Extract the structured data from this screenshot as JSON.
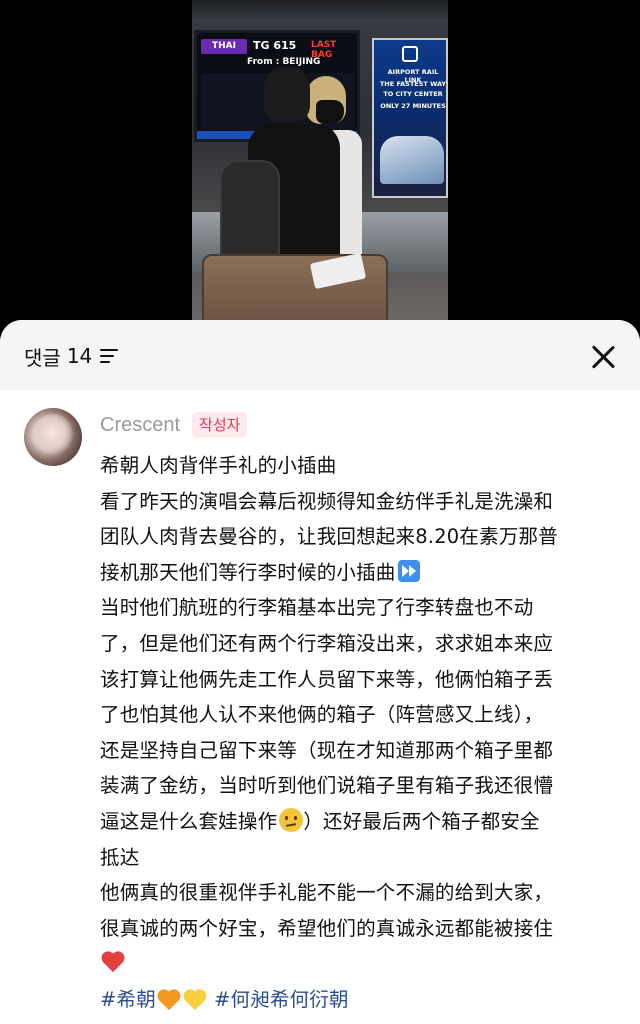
{
  "video": {
    "board": {
      "airline": "THAI",
      "flight": "TG 615",
      "status": "LAST BAG",
      "from": "From : BEIJING"
    },
    "ad": {
      "line1": "AIRPORT RAIL LINK",
      "line2": "THE FASTEST WAY",
      "line3": "TO CITY CENTER",
      "line4": "ONLY 27 MINUTES"
    }
  },
  "comments_header": {
    "label": "댓글",
    "count": "14",
    "sort_icon": "sort-lines-icon",
    "close_icon": "close-icon"
  },
  "comment": {
    "author": "Crescent",
    "author_badge": "작성자",
    "lines": [
      "希朝人肉背伴手礼的小插曲",
      "看了昨天的演唱会幕后视频得知金纺伴手礼是洗澡和",
      "团队人肉背去曼谷的，让我回想起来8.20在素万那普",
      "接机那天他们等行李时候的小插曲",
      "当时他们航班的行李箱基本出完了行李转盘也不动",
      "了，但是他们还有两个行李箱没出来，求求姐本来应",
      "该打算让他俩先走工作人员留下来等，他俩怕箱子丢",
      "了也怕其他人认不来他俩的箱子（阵营感又上线），",
      "还是坚持自己留下来等（现在才知道那两个箱子里都",
      "装满了金纺，当时听到他们说箱子里有箱子我还很懵",
      "逼这是什么套娃操作",
      "）还好最后两个箱子都安全",
      "抵达",
      "他俩真的很重视伴手礼能不能一个不漏的给到大家，",
      "很真诚的两个好宝，希望他们的真诚永远都能被接住"
    ],
    "tags": [
      "#希朝",
      "#何昶希何衍朝"
    ],
    "emojis": [
      "fast-forward-icon",
      "raised-eyebrow-face-icon",
      "heart-on-fire-icon",
      "orange-heart-icon",
      "yellow-heart-icon"
    ]
  }
}
